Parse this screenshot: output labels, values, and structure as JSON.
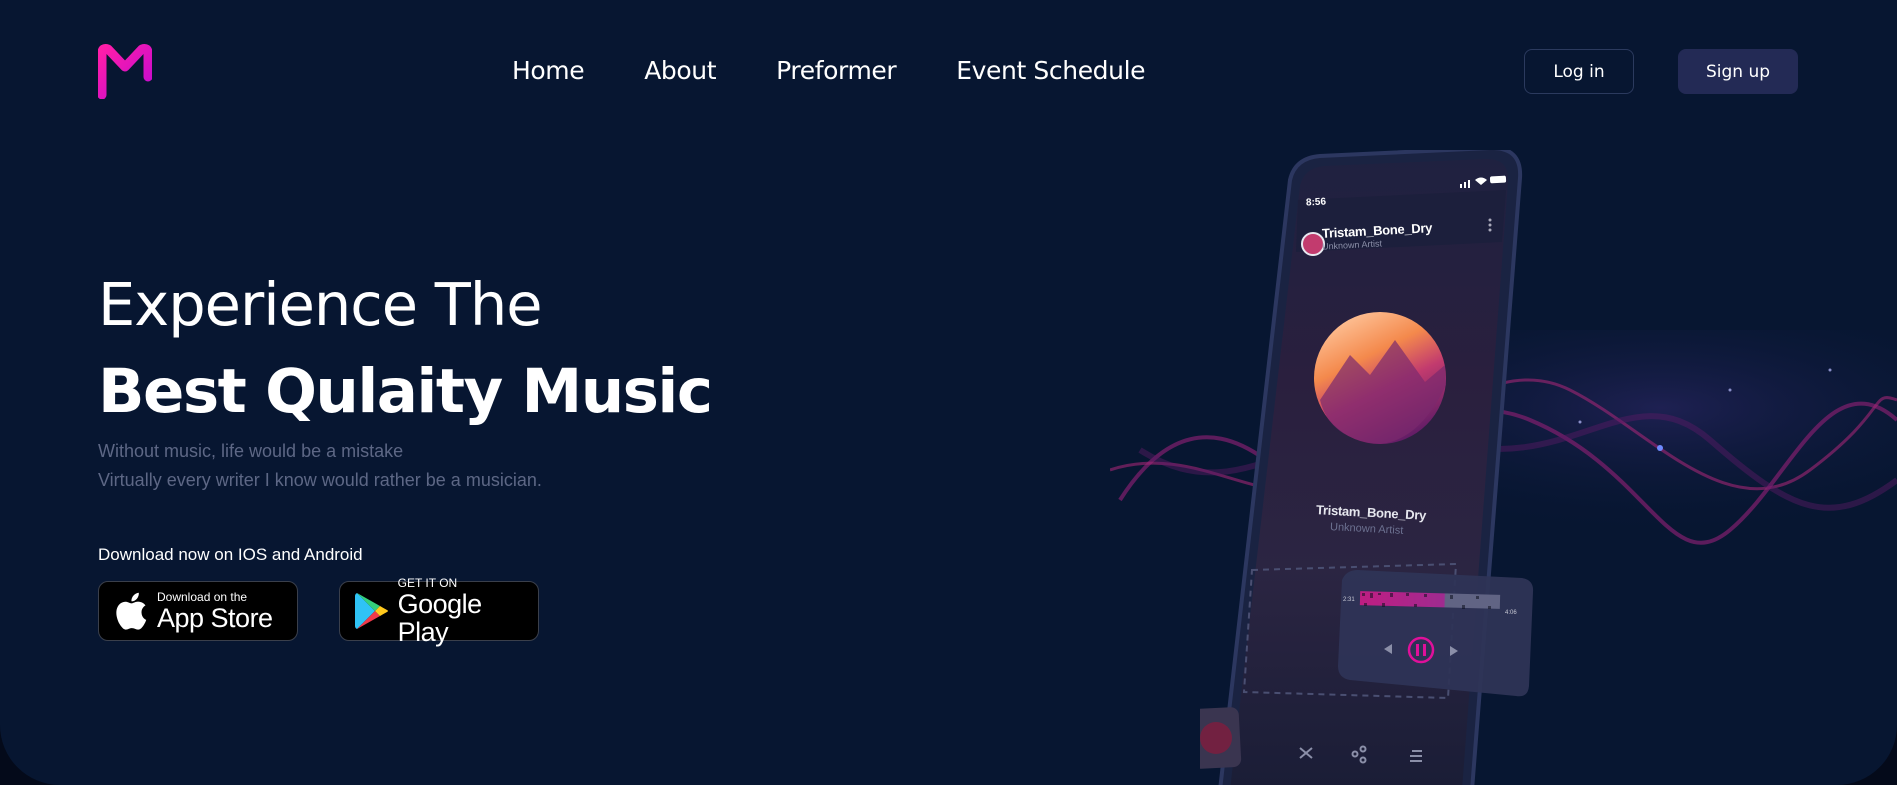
{
  "header": {
    "logo_letter": "M",
    "nav": [
      "Home",
      "About",
      "Preformer",
      "Event Schedule"
    ],
    "login_label": "Log in",
    "signup_label": "Sign up"
  },
  "hero": {
    "headline_light": "Experience The",
    "headline_bold": "Best Qulaity Music",
    "subtext_line1": "Without music, life would be a mistake",
    "subtext_line2": "Virtually every writer I know would rather be a musician.",
    "download_label": "Download now on IOS and Android"
  },
  "badges": {
    "appstore_small": "Download on the",
    "appstore_big": "App Store",
    "google_small": "GET IT ON",
    "google_big": "Google Play"
  },
  "player": {
    "status_time": "8:56",
    "track_title": "Tristam_Bone_Dry",
    "artist": "Unknown Artist",
    "time_start": "2:31",
    "time_end": "4:06"
  },
  "colors": {
    "background": "#071631",
    "brand_magenta": "#e0109a",
    "brand_pink": "#ff1ea8",
    "signup_bg": "#232a55"
  },
  "icons": [
    "logo-m-icon",
    "apple-icon",
    "google-play-icon",
    "pause-icon",
    "prev-icon",
    "next-icon",
    "shuffle-icon",
    "share-icon",
    "playlist-icon",
    "heart-icon",
    "wifi-icon",
    "signal-icon",
    "battery-icon",
    "more-icon"
  ]
}
